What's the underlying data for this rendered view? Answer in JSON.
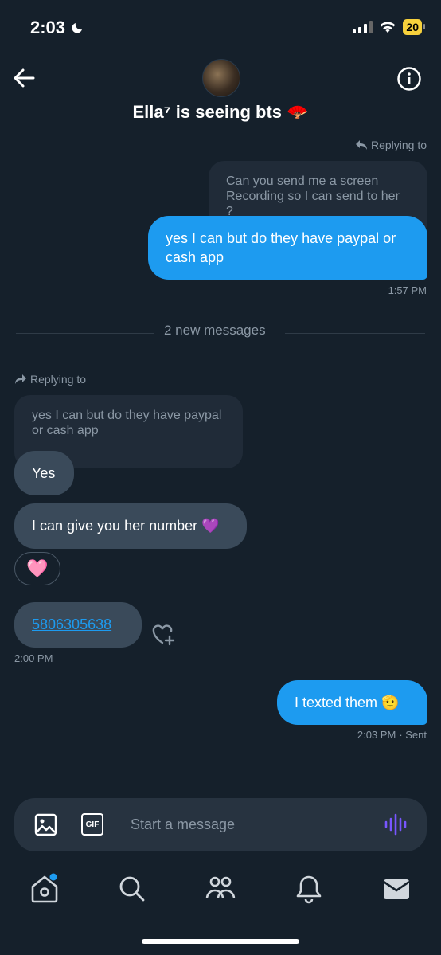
{
  "status_bar": {
    "time": "2:03",
    "battery": "20"
  },
  "header": {
    "title": "Ella⁷ is seeing bts 🪭"
  },
  "messages": {
    "reply1_label": "Replying to",
    "quoted1": "Can you send me a screen Recording so I can send to her ?",
    "out1": "yes I can but do they have paypal or cash app",
    "time1": "1:57 PM",
    "new_divider": "2 new messages",
    "reply2_label": "Replying to",
    "quoted2": "yes I can but do they have paypal or cash app",
    "in1": "Yes",
    "in2": "I can give you her number 💜",
    "reaction": "🩷",
    "phone": "5806305638",
    "time2": "2:00 PM",
    "out2": "I texted them 🫡",
    "time3": "2:03 PM",
    "status3": "· Sent"
  },
  "composer": {
    "placeholder": "Start a message",
    "gif_label": "GIF"
  },
  "colors": {
    "accent": "#1d9bf0",
    "background": "#15202b",
    "voice_accent": "#7856ff"
  },
  "nav": {
    "items": [
      "home-icon",
      "search-icon",
      "communities-icon",
      "notifications-icon",
      "messages-icon"
    ]
  }
}
